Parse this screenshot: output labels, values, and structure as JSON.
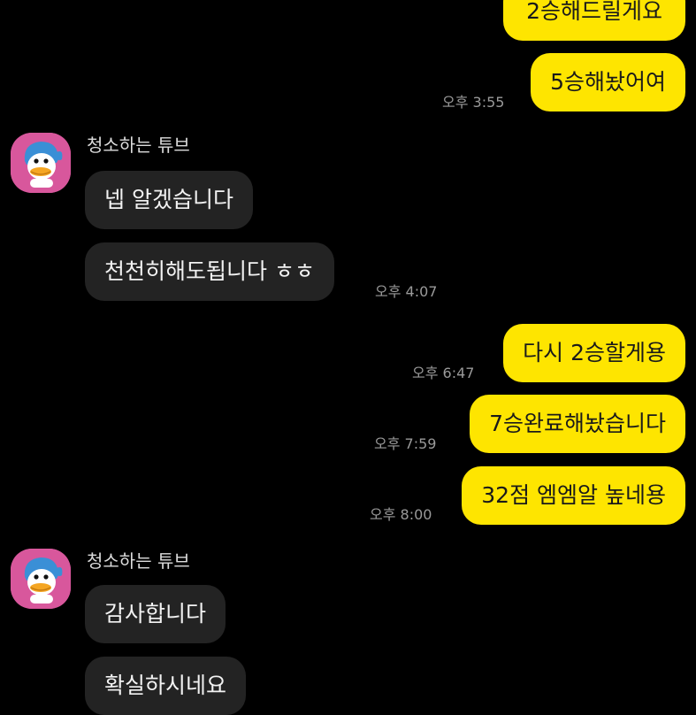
{
  "colors": {
    "background": "#000000",
    "my_bubble": "#fee500",
    "their_bubble": "#232323",
    "avatar_bg": "#d8579c",
    "timestamp": "#9a9a9a"
  },
  "sender_name": "청소하는 튜브",
  "messages": [
    {
      "from": "me",
      "text": "2승해드릴게요",
      "time": ""
    },
    {
      "from": "me",
      "text": "5승해놨어여",
      "time": "오후 3:55"
    },
    {
      "from": "them",
      "text": "넵 알겠습니다",
      "time": ""
    },
    {
      "from": "them",
      "text": "천천히해도됩니다 ㅎㅎ",
      "time": "오후 4:07"
    },
    {
      "from": "me",
      "text": "다시 2승할게용",
      "time": "오후 6:47"
    },
    {
      "from": "me",
      "text": "7승완료해놨습니다",
      "time": "오후 7:59"
    },
    {
      "from": "me",
      "text": "32점 엠엠알 높네용",
      "time": "오후 8:00"
    },
    {
      "from": "them",
      "text": "감사합니다",
      "time": ""
    },
    {
      "from": "them",
      "text": "확실하시네요",
      "time": ""
    }
  ],
  "avatar_icon": "duck-with-blue-hood-icon"
}
